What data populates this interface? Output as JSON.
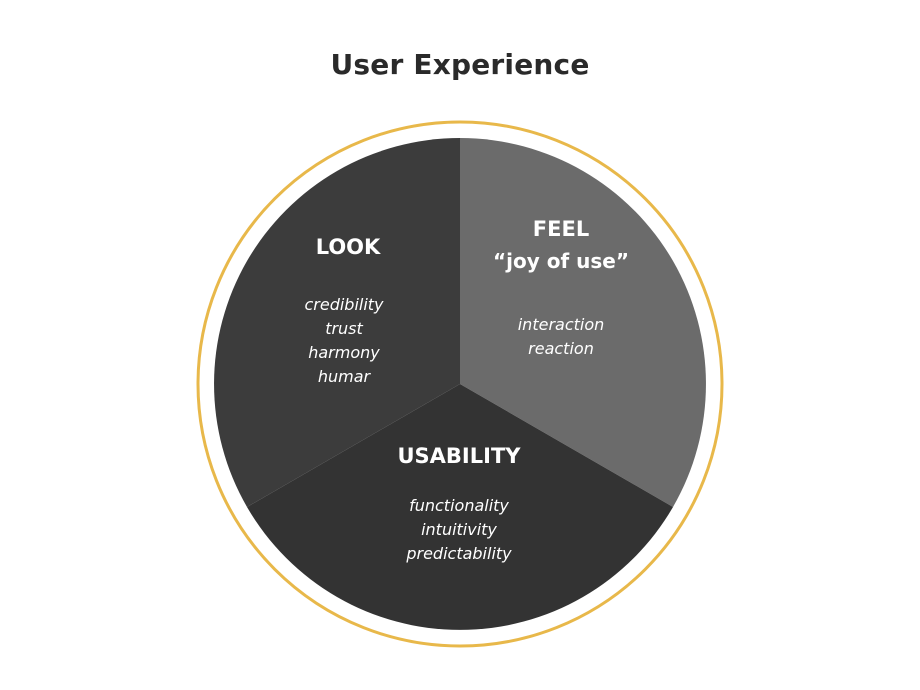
{
  "title": "User Experience",
  "colors": {
    "ring": "#E8B84A",
    "look": "#3c3c3c",
    "feel": "#6b6b6b",
    "usability": "#333333",
    "text": "#ffffff"
  },
  "segments": {
    "look": {
      "title": "LOOK",
      "items": [
        "credibility",
        "trust",
        "harmony",
        "humar"
      ]
    },
    "feel": {
      "title": "FEEL",
      "subtitle": "“joy of use”",
      "items": [
        "interaction",
        "reaction"
      ]
    },
    "usability": {
      "title": "USABILITY",
      "items": [
        "functionality",
        "intuitivity",
        "predictability"
      ]
    }
  }
}
